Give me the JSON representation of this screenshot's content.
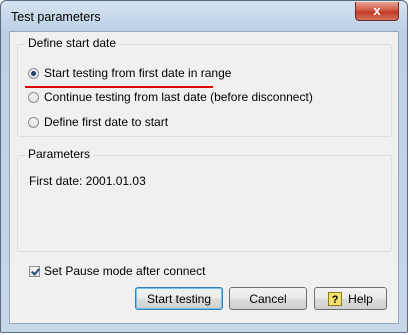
{
  "window": {
    "title": "Test parameters",
    "close_glyph": "x"
  },
  "start_date_group": {
    "label": "Define start date",
    "options": [
      {
        "label": "Start testing from first date in range",
        "checked": true
      },
      {
        "label": "Continue testing from last date (before disconnect)",
        "checked": false
      },
      {
        "label": "Define first date to start",
        "checked": false
      }
    ]
  },
  "parameters_group": {
    "label": "Parameters",
    "first_date_text": "First date: 2001.01.03"
  },
  "pause_checkbox": {
    "label": "Set Pause mode after connect",
    "checked": true
  },
  "buttons": {
    "start": "Start testing",
    "cancel": "Cancel",
    "help": "Help",
    "help_icon": "?"
  },
  "colors": {
    "highlight_underline": "#e00000"
  }
}
